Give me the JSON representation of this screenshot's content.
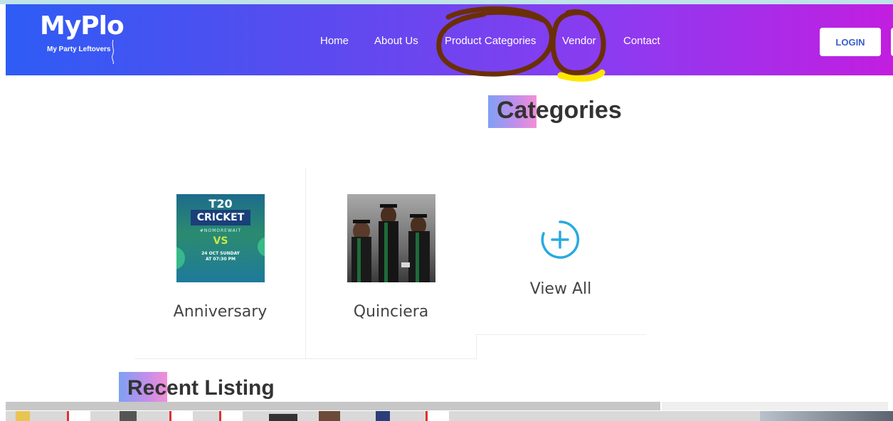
{
  "brand": {
    "logo_text": "MyPlo",
    "tagline": "My Party Leftovers"
  },
  "nav": {
    "items": [
      {
        "label": "Home"
      },
      {
        "label": "About Us"
      },
      {
        "label": "Product Categories"
      },
      {
        "label": "Vendor"
      },
      {
        "label": "Contact"
      }
    ],
    "login_label": "LOGIN"
  },
  "annotations": {
    "product_categories_mark_color": "#6b2f06",
    "vendor_mark_color": "#6b2f06",
    "vendor_highlight_color": "#ffe600"
  },
  "categories_section": {
    "title_highlight": "Cat",
    "title_rest": "egories",
    "cards": [
      {
        "label": "Anniversary",
        "image": {
          "kind": "poster",
          "line1": "T20",
          "line2": "CRICKET",
          "line3": "#NOMOREWAIT",
          "vs": "VS",
          "date": "24 OCT SUNDAY",
          "time": "AT 07:30 PM"
        }
      },
      {
        "label": "Quinciera",
        "image": {
          "kind": "photo-graduation"
        }
      }
    ],
    "view_all_label": "View All",
    "view_all_icon": "plus-circle-icon"
  },
  "recent_section": {
    "title_highlight": "Rec",
    "title_rest": "ent Listing"
  },
  "colors": {
    "nav_gradient_start": "#2e5cf5",
    "nav_gradient_end": "#c21ee0",
    "accent_blue": "#29a9e1"
  }
}
